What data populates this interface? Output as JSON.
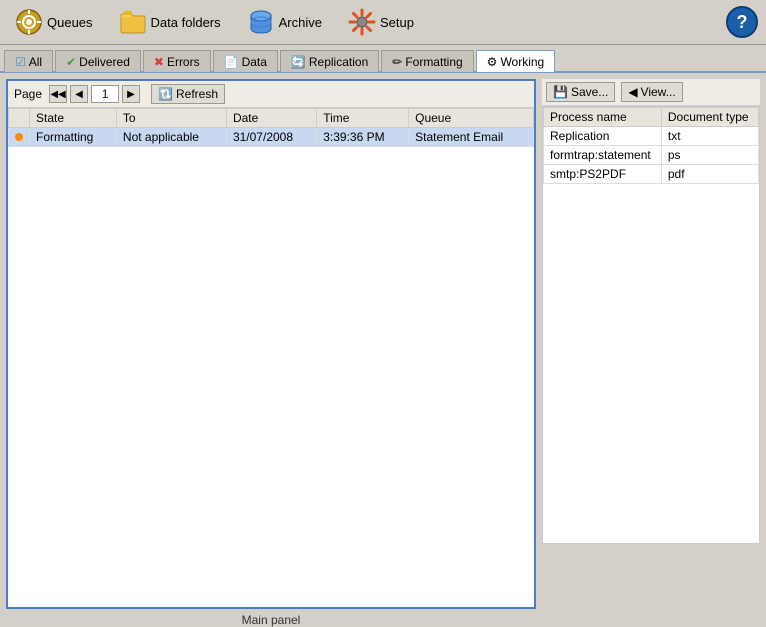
{
  "toolbar": {
    "queues_label": "Queues",
    "data_folders_label": "Data folders",
    "archive_label": "Archive",
    "setup_label": "Setup",
    "help_label": "?"
  },
  "tabs": [
    {
      "id": "all",
      "label": "All",
      "icon": "☑",
      "active": false
    },
    {
      "id": "delivered",
      "label": "Delivered",
      "icon": "✔",
      "active": false
    },
    {
      "id": "errors",
      "label": "Errors",
      "icon": "✖",
      "active": false
    },
    {
      "id": "data",
      "label": "Data",
      "icon": "📄",
      "active": false
    },
    {
      "id": "replication",
      "label": "Replication",
      "icon": "🔄",
      "active": false
    },
    {
      "id": "formatting",
      "label": "Formatting",
      "icon": "✏",
      "active": false
    },
    {
      "id": "working",
      "label": "Working",
      "icon": "⚙",
      "active": true
    }
  ],
  "pagination": {
    "page_label": "Page",
    "page_value": "1",
    "refresh_label": "Refresh"
  },
  "table": {
    "columns": [
      "State",
      "To",
      "Date",
      "Time",
      "Queue"
    ],
    "rows": [
      {
        "state": "Formatting",
        "to": "Not applicable",
        "date": "31/07/2008",
        "time": "3:39:36 PM",
        "queue": "Statement Email",
        "selected": true
      }
    ]
  },
  "main_panel_label": "Main panel",
  "right_panel": {
    "save_label": "Save...",
    "view_label": "View...",
    "columns": [
      "Process name",
      "Document type"
    ],
    "rows": [
      {
        "process": "Replication",
        "doc_type": "txt"
      },
      {
        "process": "formtrap:statement",
        "doc_type": "ps"
      },
      {
        "process": "smtp:PS2PDF",
        "doc_type": "pdf"
      }
    ]
  }
}
